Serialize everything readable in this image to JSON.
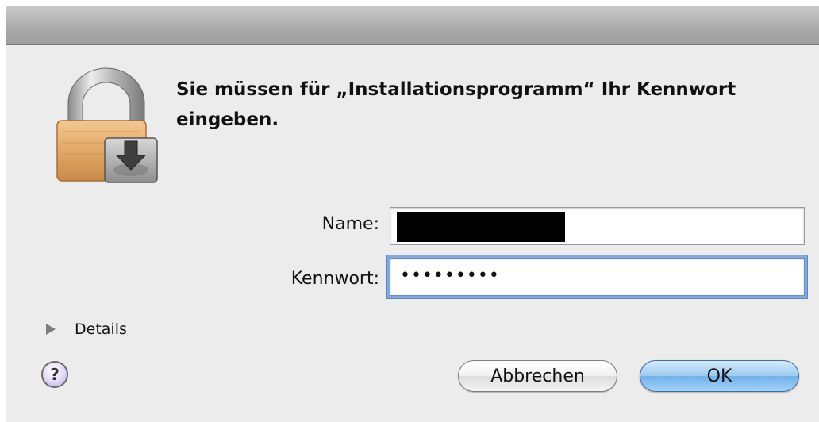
{
  "dialog": {
    "message": "Sie müssen für „Installationsprogramm“ Ihr Kennwort eingeben.",
    "name_label": "Name:",
    "password_label": "Kennwort:",
    "password_value": "•••••••••",
    "details_label": "Details",
    "help_label": "?",
    "cancel_label": "Abbrechen",
    "ok_label": "OK"
  },
  "icons": {
    "lock": "lock-with-installer-disk-icon",
    "disclosure": "disclosure-triangle-right-icon",
    "help": "help-icon"
  },
  "colors": {
    "window_bg": "#ececec",
    "default_button": "#8cc2f0",
    "focus_ring": "#7fa9e0",
    "lock_body": "#e7b070"
  }
}
